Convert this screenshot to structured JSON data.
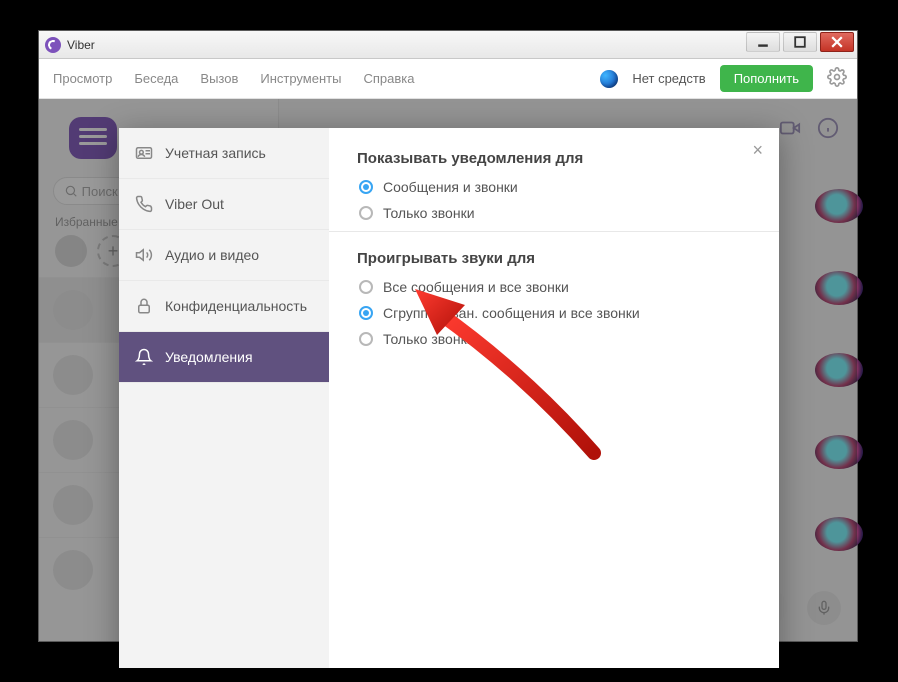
{
  "window": {
    "title": "Viber"
  },
  "menu": {
    "items": [
      "Просмотр",
      "Беседа",
      "Вызов",
      "Инструменты",
      "Справка"
    ],
    "balance": "Нет средств",
    "topup": "Пополнить"
  },
  "sidebar_bg": {
    "search_placeholder": "Поиск",
    "favorites_label": "Избранные"
  },
  "settings": {
    "close_label": "×",
    "nav": [
      {
        "icon": "id-card-icon",
        "label": "Учетная запись"
      },
      {
        "icon": "phone-out-icon",
        "label": "Viber Out"
      },
      {
        "icon": "speaker-icon",
        "label": "Аудио и видео"
      },
      {
        "icon": "lock-icon",
        "label": "Конфиденциальность"
      },
      {
        "icon": "bell-icon",
        "label": "Уведомления"
      }
    ],
    "active_nav": 4,
    "sections": [
      {
        "title": "Показывать уведомления для",
        "options": [
          {
            "label": "Сообщения и звонки",
            "selected": true
          },
          {
            "label": "Только звонки",
            "selected": false
          }
        ]
      },
      {
        "title": "Проигрывать звуки для",
        "options": [
          {
            "label": "Все сообщения и все звонки",
            "selected": false
          },
          {
            "label": "Сгруппирован. сообщения и все звонки",
            "selected": true
          },
          {
            "label": "Только звонки",
            "selected": false
          }
        ]
      }
    ]
  }
}
